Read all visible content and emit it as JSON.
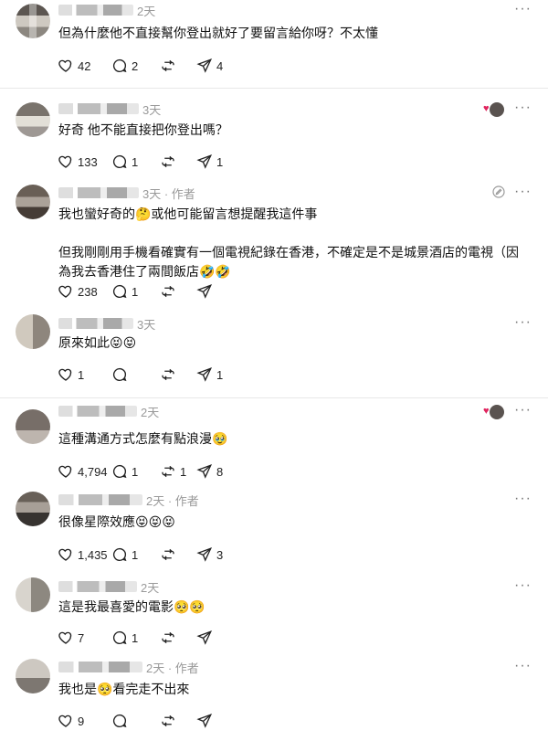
{
  "posts": [
    {
      "time": "2天",
      "author_tag": "",
      "lines": [
        "但為什麼他不直接幫你登出就好了要留言給你呀？不太懂"
      ],
      "likes": "42",
      "replies": "2",
      "reposts": "",
      "shares": "4",
      "has_like_avatar": false,
      "has_edit": false
    },
    {
      "time": "3天",
      "author_tag": "",
      "lines": [
        "好奇 他不能直接把你登出嗎？"
      ],
      "likes": "133",
      "replies": "1",
      "reposts": "",
      "shares": "1",
      "has_like_avatar": true,
      "has_edit": false
    },
    {
      "time": "3天 · 作者",
      "author_tag": "",
      "lines": [
        "我也蠻好奇的🤔或他可能留言想提醒我這件事",
        "",
        "但我剛剛用手機看確實有一個電視紀錄在香港，不確定是不是城景酒店的電視（因",
        "為我去香港住了兩間飯店🤣🤣"
      ],
      "likes": "238",
      "replies": "1",
      "reposts": "",
      "shares": "",
      "has_like_avatar": false,
      "has_edit": true
    },
    {
      "time": "3天",
      "author_tag": "",
      "lines": [
        "原來如此😝😝"
      ],
      "likes": "1",
      "replies": "",
      "reposts": "",
      "shares": "1",
      "has_like_avatar": false,
      "has_edit": false
    },
    {
      "time": "2天",
      "author_tag": "",
      "lines": [
        "這種溝通方式怎麼有點浪漫🥹"
      ],
      "likes": "4,794",
      "replies": "1",
      "reposts": "1",
      "shares": "8",
      "has_like_avatar": true,
      "has_edit": false
    },
    {
      "time": "2天 · 作者",
      "author_tag": "",
      "lines": [
        "很像星際效應😝😝😝"
      ],
      "likes": "1,435",
      "replies": "1",
      "reposts": "",
      "shares": "3",
      "has_like_avatar": false,
      "has_edit": false
    },
    {
      "time": "2天",
      "author_tag": "",
      "lines": [
        "這是我最喜愛的電影🥺🥺"
      ],
      "likes": "7",
      "replies": "1",
      "reposts": "",
      "shares": "",
      "has_like_avatar": false,
      "has_edit": false
    },
    {
      "time": "2天 · 作者",
      "author_tag": "",
      "lines": [
        "我也是🥺看完走不出來"
      ],
      "likes": "9",
      "replies": "",
      "reposts": "",
      "shares": "",
      "has_like_avatar": false,
      "has_edit": false
    }
  ],
  "icons": {
    "like": "heart-icon",
    "reply": "comment-icon",
    "repost": "repost-icon",
    "share": "send-icon",
    "more": "more-icon",
    "edit": "edit-icon"
  },
  "colors": {
    "meta": "#9a9a9a",
    "heart": "#e0245e",
    "divider": "#e8e8e8"
  }
}
